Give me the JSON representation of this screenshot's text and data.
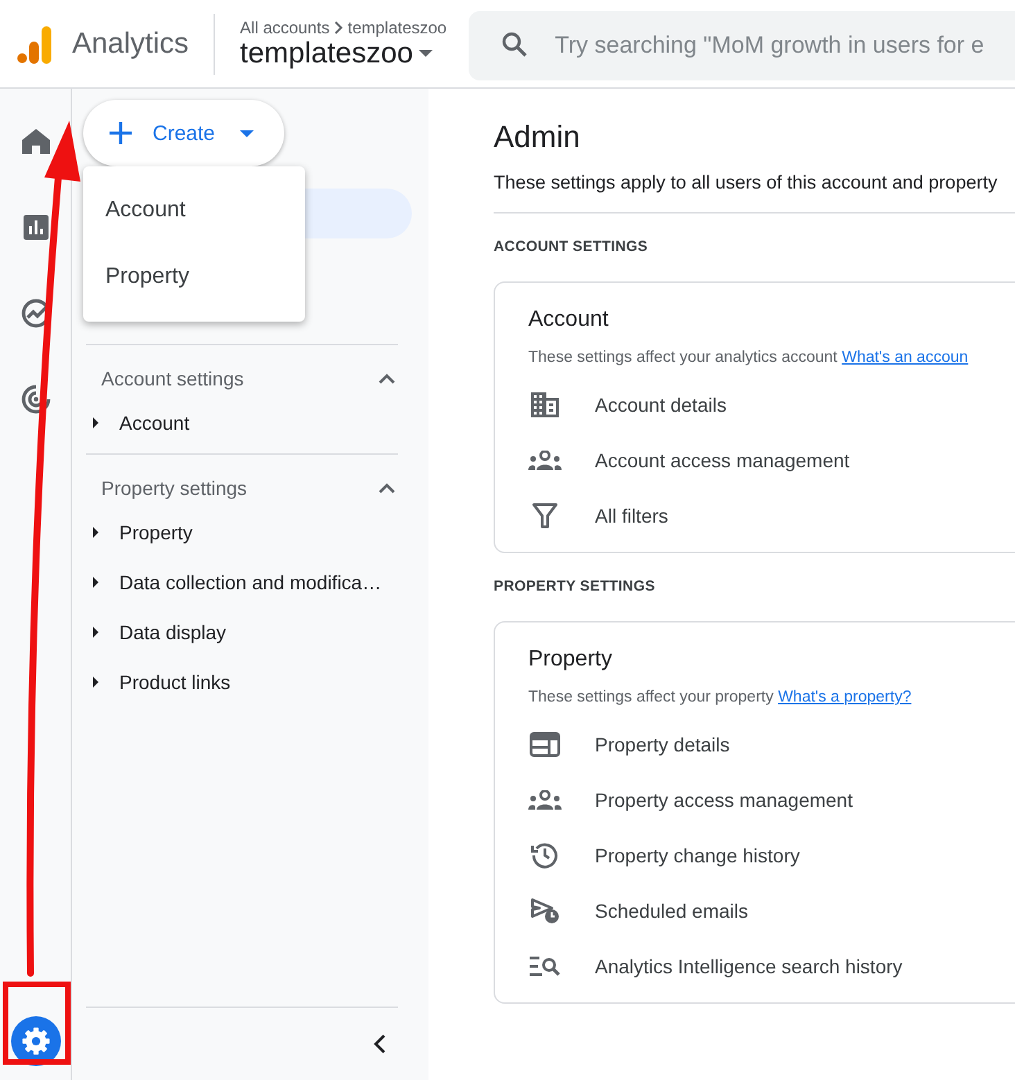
{
  "header": {
    "product": "Analytics",
    "breadcrumb_root": "All accounts",
    "breadcrumb_current": "templateszoo",
    "account": "templateszoo",
    "search": {
      "placeholder": "Try searching \"MoM growth in users for e"
    }
  },
  "rail": [
    {
      "kind": "home",
      "selected": false
    },
    {
      "kind": "reports",
      "selected": false
    },
    {
      "kind": "explore",
      "selected": false
    },
    {
      "kind": "advertising",
      "selected": false
    },
    {
      "kind": "admin",
      "selected": true
    }
  ],
  "create_button": {
    "label": "Create"
  },
  "create_menu": [
    {
      "label": "Account"
    },
    {
      "label": "Property"
    }
  ],
  "nav": [
    {
      "title": "Account settings",
      "expanded": true,
      "items": [
        {
          "label": "Account",
          "expanded": false
        }
      ]
    },
    {
      "title": "Property settings",
      "expanded": true,
      "items": [
        {
          "label": "Property",
          "expanded": false
        },
        {
          "label": "Data collection and modifica…",
          "expanded": false
        },
        {
          "label": "Data display",
          "expanded": false
        },
        {
          "label": "Product links",
          "expanded": false
        }
      ]
    }
  ],
  "main": {
    "title": "Admin",
    "subtitle": "These settings apply to all users of this account and property",
    "sections": [
      {
        "heading": "ACCOUNT SETTINGS",
        "card": {
          "title": "Account",
          "description": "These settings affect your analytics account",
          "link": "What's an accoun",
          "items": [
            {
              "kind": "building",
              "label": "Account details"
            },
            {
              "kind": "people",
              "label": "Account access management"
            },
            {
              "kind": "filter",
              "label": "All filters"
            }
          ]
        }
      },
      {
        "heading": "PROPERTY SETTINGS",
        "card": {
          "title": "Property",
          "description": "These settings affect your property",
          "link": "What's a property?",
          "items": [
            {
              "kind": "window",
              "label": "Property details"
            },
            {
              "kind": "people",
              "label": "Property access management"
            },
            {
              "kind": "history",
              "label": "Property change history"
            },
            {
              "kind": "send-clock",
              "label": "Scheduled emails"
            },
            {
              "kind": "list-search",
              "label": "Analytics Intelligence search history"
            }
          ]
        }
      }
    ]
  }
}
